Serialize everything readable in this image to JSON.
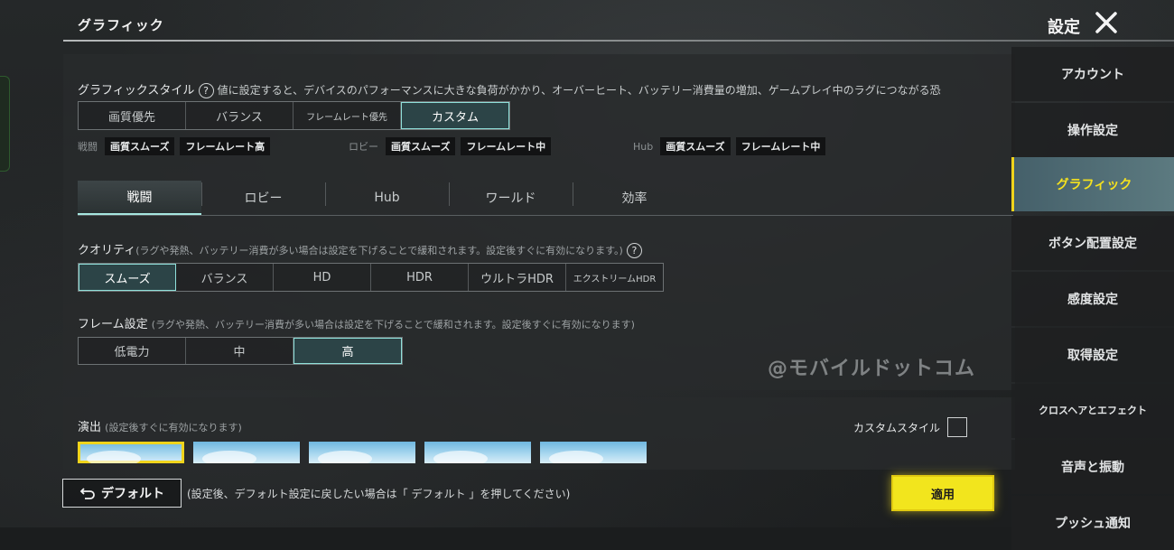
{
  "header": {
    "page_title": "グラフィック",
    "settings_title": "設定"
  },
  "graphics_style": {
    "label": "グラフィックスタイル",
    "help": "?",
    "note": "値に設定すると、デバイスのパフォーマンスに大きな負荷がかかり、オーバーヒート、バッテリー消費量の増加、ゲームプレイ中のラグにつながる恐",
    "options": [
      "画質優先",
      "バランス",
      "フレームレート優先",
      "カスタム"
    ],
    "selected": "カスタム"
  },
  "presets": [
    {
      "label": "戦闘",
      "quality": "画質スムーズ",
      "fps": "フレームレート高"
    },
    {
      "label": "ロビー",
      "quality": "画質スムーズ",
      "fps": "フレームレート中"
    },
    {
      "label": "Hub",
      "quality": "画質スムーズ",
      "fps": "フレームレート中"
    }
  ],
  "tabs": [
    "戦闘",
    "ロビー",
    "Hub",
    "ワールド",
    "効率"
  ],
  "active_tab": "戦闘",
  "quality": {
    "label": "クオリティ",
    "note": "(ラグや発熱、バッテリー消費が多い場合は設定を下げることで緩和されます。設定後すぐに有効になります。)",
    "help": "?",
    "options": [
      "スムーズ",
      "バランス",
      "HD",
      "HDR",
      "ウルトラHDR",
      "エクストリームHDR"
    ],
    "selected": "スムーズ"
  },
  "frame": {
    "label": "フレーム設定",
    "note": "(ラグや発熱、バッテリー消費が多い場合は設定を下げることで緩和されます。設定後すぐに有効になります)",
    "options": [
      "低電力",
      "中",
      "高"
    ],
    "selected": "高"
  },
  "watermark": "@モバイルドットコム",
  "effects": {
    "label": "演出",
    "note": "(設定後すぐに有効になります)",
    "custom_style_label": "カスタムスタイル",
    "custom_style_checked": false,
    "thumbnail_count": 5,
    "selected_index": 0
  },
  "footer": {
    "default_label": "デフォルト",
    "default_note": "(設定後、デフォルト設定に戻したい場合は「 デフォルト 」を押してください)",
    "apply_label": "適用"
  },
  "sidebar": {
    "items": [
      "アカウント",
      "操作設定",
      "グラフィック",
      "ボタン配置設定",
      "感度設定",
      "取得設定",
      "クロスヘアとエフェクト",
      "音声と振動",
      "プッシュ通知"
    ],
    "active": "グラフィック"
  },
  "colors": {
    "accent_yellow": "#f2e51d",
    "active_cyan": "#8fe0da"
  }
}
